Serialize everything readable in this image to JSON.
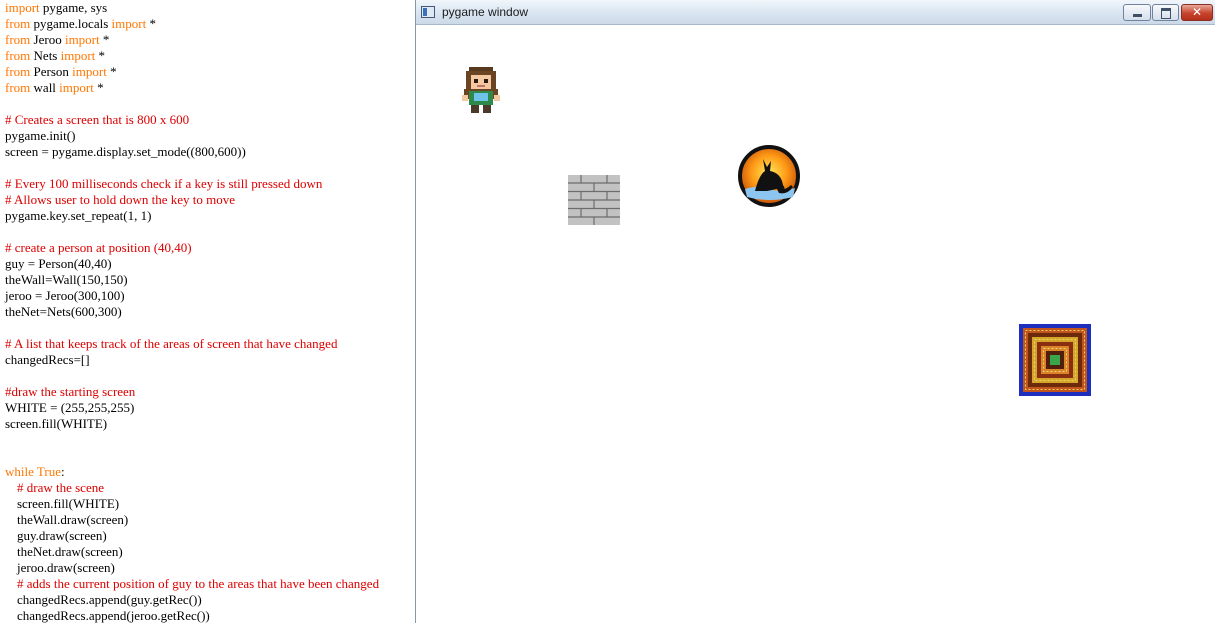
{
  "code_editor": {
    "lines": [
      {
        "parts": [
          {
            "text": "import",
            "style": "keyword"
          },
          {
            "text": " pygame, sys",
            "style": "plain"
          }
        ]
      },
      {
        "parts": [
          {
            "text": "from",
            "style": "keyword"
          },
          {
            "text": " pygame.locals ",
            "style": "plain"
          },
          {
            "text": "import",
            "style": "keyword"
          },
          {
            "text": " *",
            "style": "plain"
          }
        ]
      },
      {
        "parts": [
          {
            "text": "from",
            "style": "keyword"
          },
          {
            "text": " Jeroo ",
            "style": "plain"
          },
          {
            "text": "import",
            "style": "keyword"
          },
          {
            "text": " *",
            "style": "plain"
          }
        ]
      },
      {
        "parts": [
          {
            "text": "from",
            "style": "keyword"
          },
          {
            "text": " Nets ",
            "style": "plain"
          },
          {
            "text": "import",
            "style": "keyword"
          },
          {
            "text": " *",
            "style": "plain"
          }
        ]
      },
      {
        "parts": [
          {
            "text": "from",
            "style": "keyword"
          },
          {
            "text": " Person ",
            "style": "plain"
          },
          {
            "text": "import",
            "style": "keyword"
          },
          {
            "text": " *",
            "style": "plain"
          }
        ]
      },
      {
        "parts": [
          {
            "text": "from",
            "style": "keyword"
          },
          {
            "text": " wall ",
            "style": "plain"
          },
          {
            "text": "import",
            "style": "keyword"
          },
          {
            "text": " *",
            "style": "plain"
          }
        ]
      },
      {
        "parts": []
      },
      {
        "parts": [
          {
            "text": "# Creates a screen that is 800 x 600",
            "style": "comment"
          }
        ]
      },
      {
        "parts": [
          {
            "text": "pygame.init()",
            "style": "plain"
          }
        ]
      },
      {
        "parts": [
          {
            "text": "screen = pygame.display.set_mode((800,600))",
            "style": "plain"
          }
        ]
      },
      {
        "parts": []
      },
      {
        "parts": [
          {
            "text": "# Every 100 milliseconds check if a key is still pressed down",
            "style": "comment"
          }
        ]
      },
      {
        "parts": [
          {
            "text": "# Allows user to hold down the key to move",
            "style": "comment"
          }
        ]
      },
      {
        "parts": [
          {
            "text": "pygame.key.set_repeat(1, 1)",
            "style": "plain"
          }
        ]
      },
      {
        "parts": []
      },
      {
        "parts": [
          {
            "text": "# create a person at position (40,40)",
            "style": "comment"
          }
        ]
      },
      {
        "parts": [
          {
            "text": "guy = Person(40,40)",
            "style": "plain"
          }
        ]
      },
      {
        "parts": [
          {
            "text": "theWall=Wall(150,150)",
            "style": "plain"
          }
        ]
      },
      {
        "parts": [
          {
            "text": "jeroo = Jeroo(300,100)",
            "style": "plain"
          }
        ]
      },
      {
        "parts": [
          {
            "text": "theNet=Nets(600,300)",
            "style": "plain"
          }
        ]
      },
      {
        "parts": []
      },
      {
        "parts": [
          {
            "text": "# A list that keeps track of the areas of screen that have changed",
            "style": "comment"
          }
        ]
      },
      {
        "parts": [
          {
            "text": "changedRecs=[]",
            "style": "plain"
          }
        ]
      },
      {
        "parts": []
      },
      {
        "parts": [
          {
            "text": "#draw the starting screen",
            "style": "comment"
          }
        ]
      },
      {
        "parts": [
          {
            "text": "WHITE = (255,255,255)",
            "style": "plain"
          }
        ]
      },
      {
        "parts": [
          {
            "text": "screen.fill(WHITE)",
            "style": "plain"
          }
        ]
      },
      {
        "parts": []
      },
      {
        "parts": []
      },
      {
        "parts": [
          {
            "text": "while",
            "style": "keyword"
          },
          {
            "text": " ",
            "style": "plain"
          },
          {
            "text": "True",
            "style": "keyword"
          },
          {
            "text": ":",
            "style": "plain"
          }
        ]
      },
      {
        "indent": true,
        "parts": [
          {
            "text": "# draw the scene",
            "style": "comment"
          }
        ]
      },
      {
        "indent": true,
        "parts": [
          {
            "text": "screen.fill(WHITE)",
            "style": "plain"
          }
        ]
      },
      {
        "indent": true,
        "parts": [
          {
            "text": "theWall.draw(screen)",
            "style": "plain"
          }
        ]
      },
      {
        "indent": true,
        "parts": [
          {
            "text": "guy.draw(screen)",
            "style": "plain"
          }
        ]
      },
      {
        "indent": true,
        "parts": [
          {
            "text": "theNet.draw(screen)",
            "style": "plain"
          }
        ]
      },
      {
        "indent": true,
        "parts": [
          {
            "text": "jeroo.draw(screen)",
            "style": "plain"
          }
        ]
      },
      {
        "indent": true,
        "parts": [
          {
            "text": "# adds the current position of guy to the areas that have been changed",
            "style": "comment"
          }
        ]
      },
      {
        "indent": true,
        "parts": [
          {
            "text": "changedRecs.append(guy.getRec())",
            "style": "plain"
          }
        ]
      },
      {
        "indent": true,
        "parts": [
          {
            "text": "changedRecs.append(jeroo.getRec())",
            "style": "plain"
          }
        ]
      }
    ],
    "colors": {
      "keyword": "#ff7700",
      "comment": "#dd0000",
      "plain": "#000000"
    }
  },
  "window": {
    "title": "pygame window",
    "icon": "pygame-window-icon",
    "controls": {
      "minimize": "minimize-icon",
      "maximize": "maximize-icon",
      "close": "close-icon",
      "close_glyph": "✕"
    },
    "background": "#ffffff",
    "sprites": [
      {
        "name": "person-sprite",
        "icon": "person-sprite"
      },
      {
        "name": "wall-sprite",
        "icon": "brick-wall-sprite"
      },
      {
        "name": "jeroo-sprite",
        "icon": "kangaroo-sunset-sprite"
      },
      {
        "name": "net-sprite",
        "icon": "net-tile-sprite"
      }
    ]
  }
}
